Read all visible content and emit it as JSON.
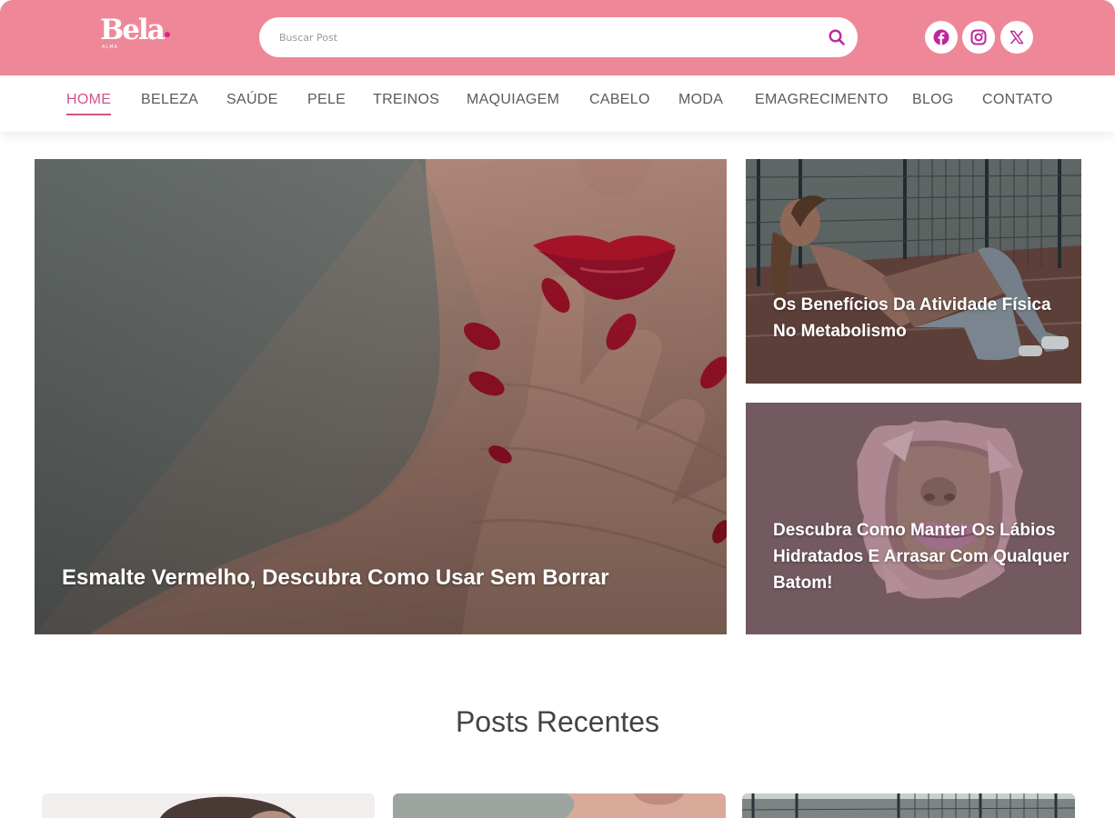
{
  "header": {
    "logo_text": "Bela",
    "logo_subtext": "ALMA",
    "search": {
      "placeholder": "Buscar Post",
      "value": ""
    },
    "social": [
      "facebook-icon",
      "instagram-icon",
      "x-icon"
    ]
  },
  "colors": {
    "topbar": "#ee8898",
    "accent": "#d0558a",
    "search_icon": "#c0269a"
  },
  "nav": {
    "items": [
      {
        "label": "HOME",
        "active": true
      },
      {
        "label": "BELEZA"
      },
      {
        "label": "SAÚDE"
      },
      {
        "label": "PELE"
      },
      {
        "label": "TREINOS"
      },
      {
        "label": "MAQUIAGEM"
      },
      {
        "label": "CABELO"
      },
      {
        "label": "MODA"
      },
      {
        "label": "EMAGRECIMENTO"
      },
      {
        "label": "BLOG"
      },
      {
        "label": "CONTATO"
      }
    ]
  },
  "featured": {
    "main": {
      "title": "Esmalte Vermelho, Descubra Como Usar Sem Borrar"
    },
    "side": [
      {
        "title": "Os Benefícios Da Atividade Física No Metabolismo"
      },
      {
        "title": "Descubra Como Manter Os Lábios Hidratados E Arrasar Com Qualquer Batom!"
      }
    ]
  },
  "recent": {
    "title": "Posts Recentes"
  }
}
